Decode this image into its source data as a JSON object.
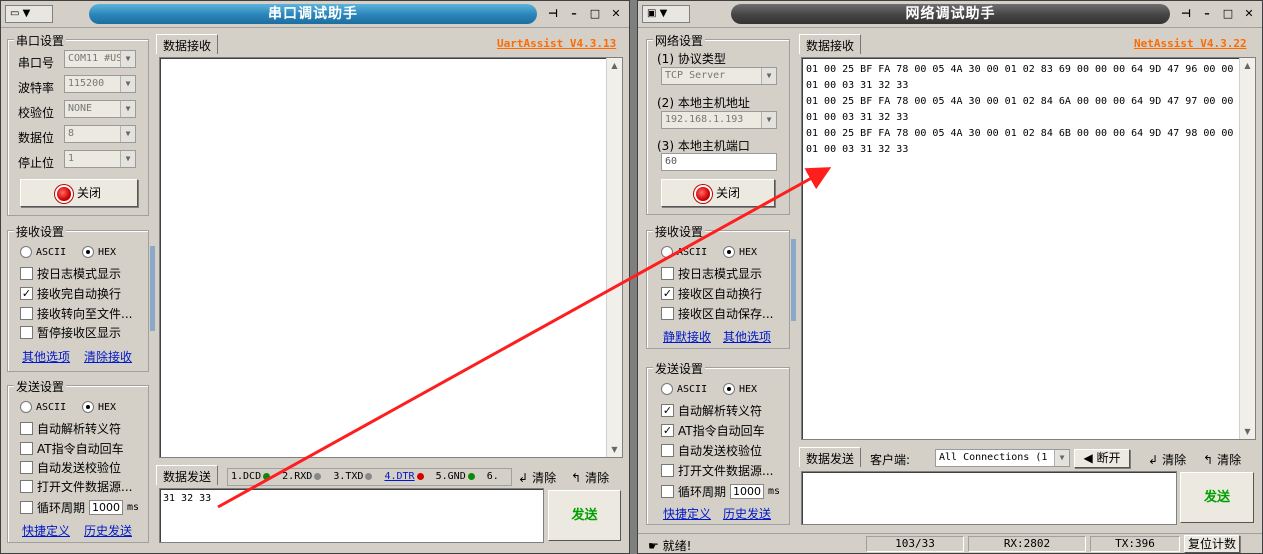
{
  "uart": {
    "sysmenu": "▼",
    "title": "串口调试助手",
    "version": "UartAssist V4.3.13",
    "serial_group": "串口设置",
    "port_label": "串口号",
    "port_value": "COM11 #US",
    "baud_label": "波特率",
    "baud_value": "115200",
    "parity_label": "校验位",
    "parity_value": "NONE",
    "databits_label": "数据位",
    "databits_value": "8",
    "stopbits_label": "停止位",
    "stopbits_value": "1",
    "close_button": "关闭",
    "recv_group": "接收设置",
    "ascii": "ASCII",
    "hex": "HEX",
    "recv_options": [
      "按日志模式显示",
      "接收完自动换行",
      "接收转向至文件...",
      "暂停接收区显示"
    ],
    "recv_checked": [
      false,
      true,
      false,
      false
    ],
    "more_options": "其他选项",
    "clear_recv": "清除接收",
    "send_group": "发送设置",
    "send_options": [
      "自动解析转义符",
      "AT指令自动回车",
      "自动发送校验位",
      "打开文件数据源..."
    ],
    "loop_label": "循环周期",
    "loop_value": "1000",
    "loop_unit": "ms",
    "shortcut": "快捷定义",
    "history": "历史发送",
    "recv_tab": "数据接收",
    "send_tab": "数据发送",
    "signals": [
      "1.DCD",
      "2.RXD",
      "3.TXD",
      "4.DTR",
      "5.GND",
      "6."
    ],
    "clear1": "清除",
    "clear2": "清除",
    "send_text": "31 32 33",
    "send_button": "发送"
  },
  "net": {
    "sysmenu": "▼",
    "title": "网络调试助手",
    "version": "NetAssist V4.3.22",
    "net_group": "网络设置",
    "proto_label": "(1) 协议类型",
    "proto_value": "TCP Server",
    "host_label": "(2) 本地主机地址",
    "host_value": "192.168.1.193",
    "port_label": "(3) 本地主机端口",
    "port_value": "60",
    "close_button": "关闭",
    "recv_group": "接收设置",
    "ascii": "ASCII",
    "hex": "HEX",
    "recv_options": [
      "按日志模式显示",
      "接收区自动换行",
      "接收区自动保存..."
    ],
    "recv_checked": [
      false,
      true,
      false
    ],
    "silent_recv": "静默接收",
    "more_options": "其他选项",
    "send_group": "发送设置",
    "send_options": [
      "自动解析转义符",
      "AT指令自动回车",
      "自动发送校验位",
      "打开文件数据源..."
    ],
    "send_checked": [
      true,
      true,
      false,
      false
    ],
    "loop_label": "循环周期",
    "loop_value": "1000",
    "loop_unit": "ms",
    "shortcut": "快捷定义",
    "history": "历史发送",
    "recv_tab": "数据接收",
    "recv_data": "01 00 25 BF FA 78 00 05 4A 30 00 01 02 83 69 00 00 00 64 9D 47 96 00 00\n01 00 03 31 32 33\n01 00 25 BF FA 78 00 05 4A 30 00 01 02 84 6A 00 00 00 64 9D 47 97 00 00\n01 00 03 31 32 33\n01 00 25 BF FA 78 00 05 4A 30 00 01 02 84 6B 00 00 00 64 9D 47 98 00 00\n01 00 03 31 32 33",
    "send_tab": "数据发送",
    "client_label": "客户端:",
    "client_value": "All Connections (1",
    "disconnect": "断开",
    "clear1": "清除",
    "clear2": "清除",
    "send_button": "发送",
    "status_ready": "就绪!",
    "status_count": "103/33",
    "status_rx": "RX:2802",
    "status_tx": "TX:396",
    "reset_count": "复位计数"
  }
}
